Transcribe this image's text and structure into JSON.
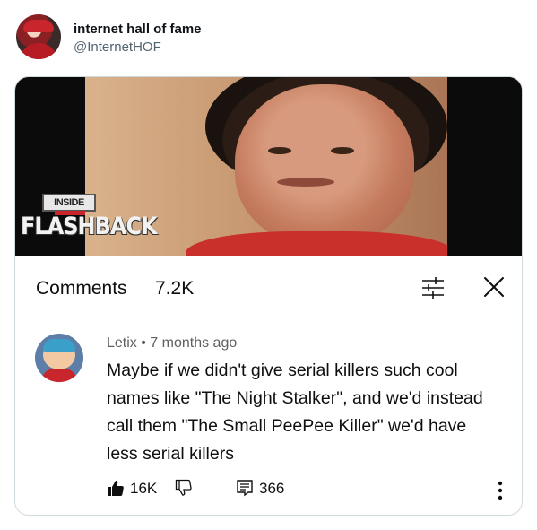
{
  "tweet": {
    "display_name": "internet hall of fame",
    "handle": "@InternetHOF"
  },
  "video": {
    "logo_top": "INSIDE",
    "logo_main": "FLASHBACK"
  },
  "comments_panel": {
    "title": "Comments",
    "count": "7.2K"
  },
  "comment": {
    "meta": "Letix • 7 months ago",
    "text": "Maybe if we didn't give serial killers such cool names like \"The Night Stalker\", and we'd instead call them \"The Small PeePee Killer\" we'd have less serial killers",
    "likes": "16K",
    "replies": "366"
  },
  "icons": [
    "like-icon",
    "dislike-icon",
    "reply-icon",
    "sort-icon",
    "close-icon",
    "more-icon"
  ]
}
